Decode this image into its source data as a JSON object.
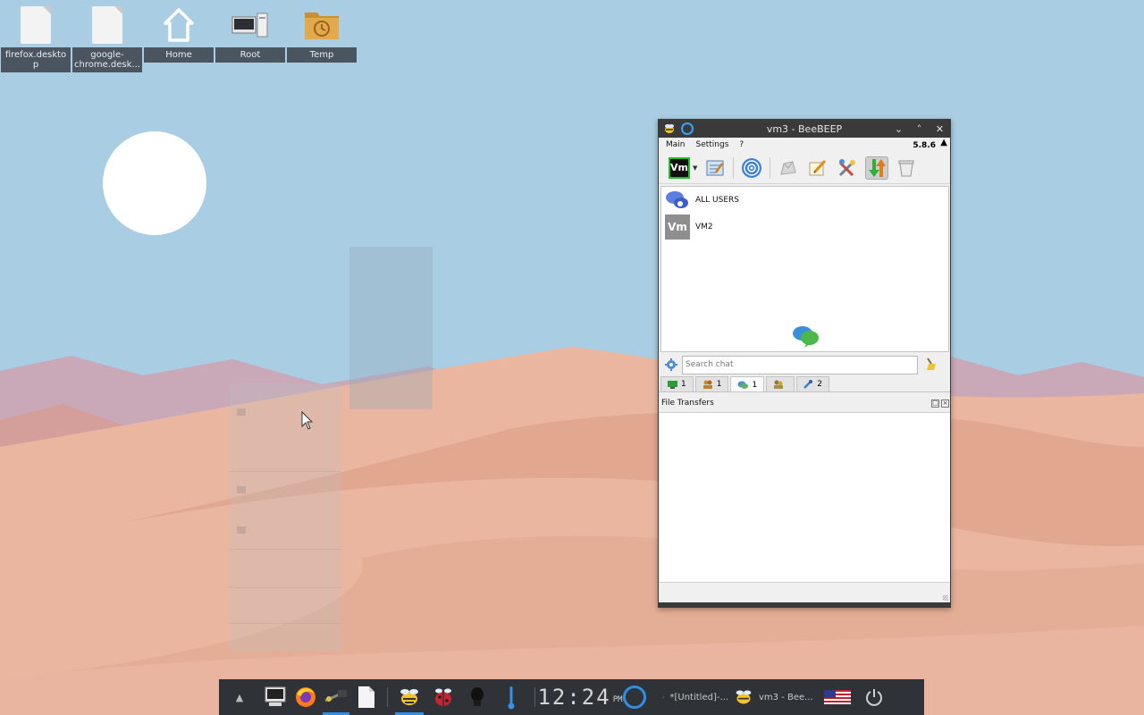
{
  "desktop": {
    "icons": [
      {
        "label": "firefox.desktop",
        "icon": "file-icon"
      },
      {
        "label": "google-chrome.desk...",
        "icon": "file-icon"
      },
      {
        "label": "Home",
        "icon": "home-icon"
      },
      {
        "label": "Root",
        "icon": "computer-icon"
      },
      {
        "label": "Temp",
        "icon": "folder-clock-icon"
      }
    ]
  },
  "window": {
    "title": "vm3 - BeeBEEP",
    "menu": {
      "main": "Main",
      "settings": "Settings",
      "help": "?"
    },
    "version": "5.8.6",
    "toolbar": {
      "vm_badge": "Vm",
      "icons": [
        "vm-status-icon",
        "dropdown-arrow-icon",
        "edit-profile-icon",
        "network-icon",
        "group-icon",
        "note-pencil-icon",
        "tools-icon",
        "file-transfer-icon",
        "trash-icon"
      ]
    },
    "users": [
      {
        "name": "ALL USERS",
        "icon": "chat-bubbles-icon"
      },
      {
        "name": "VM2",
        "avatar": "Vm"
      }
    ],
    "search": {
      "placeholder": "Search chat"
    },
    "tabs": [
      {
        "count": "1",
        "icon": "users-tab-icon"
      },
      {
        "count": "1",
        "icon": "groups-tab-icon"
      },
      {
        "count": "1",
        "icon": "chats-tab-icon"
      },
      {
        "count": "",
        "icon": "shares-tab-icon"
      },
      {
        "count": "2",
        "icon": "plugins-tab-icon"
      }
    ],
    "file_transfers": {
      "title": "File Transfers"
    }
  },
  "taskbar": {
    "clock": "12:24",
    "ampm": "PM",
    "tasks": [
      {
        "label": "*[Untitled]-...",
        "icon": "editor-icon"
      },
      {
        "label": "vm3 - Bee...",
        "icon": "beebeep-icon"
      }
    ],
    "colors": {
      "accent": "#2f8ee6",
      "panel": "#2f3236"
    }
  }
}
